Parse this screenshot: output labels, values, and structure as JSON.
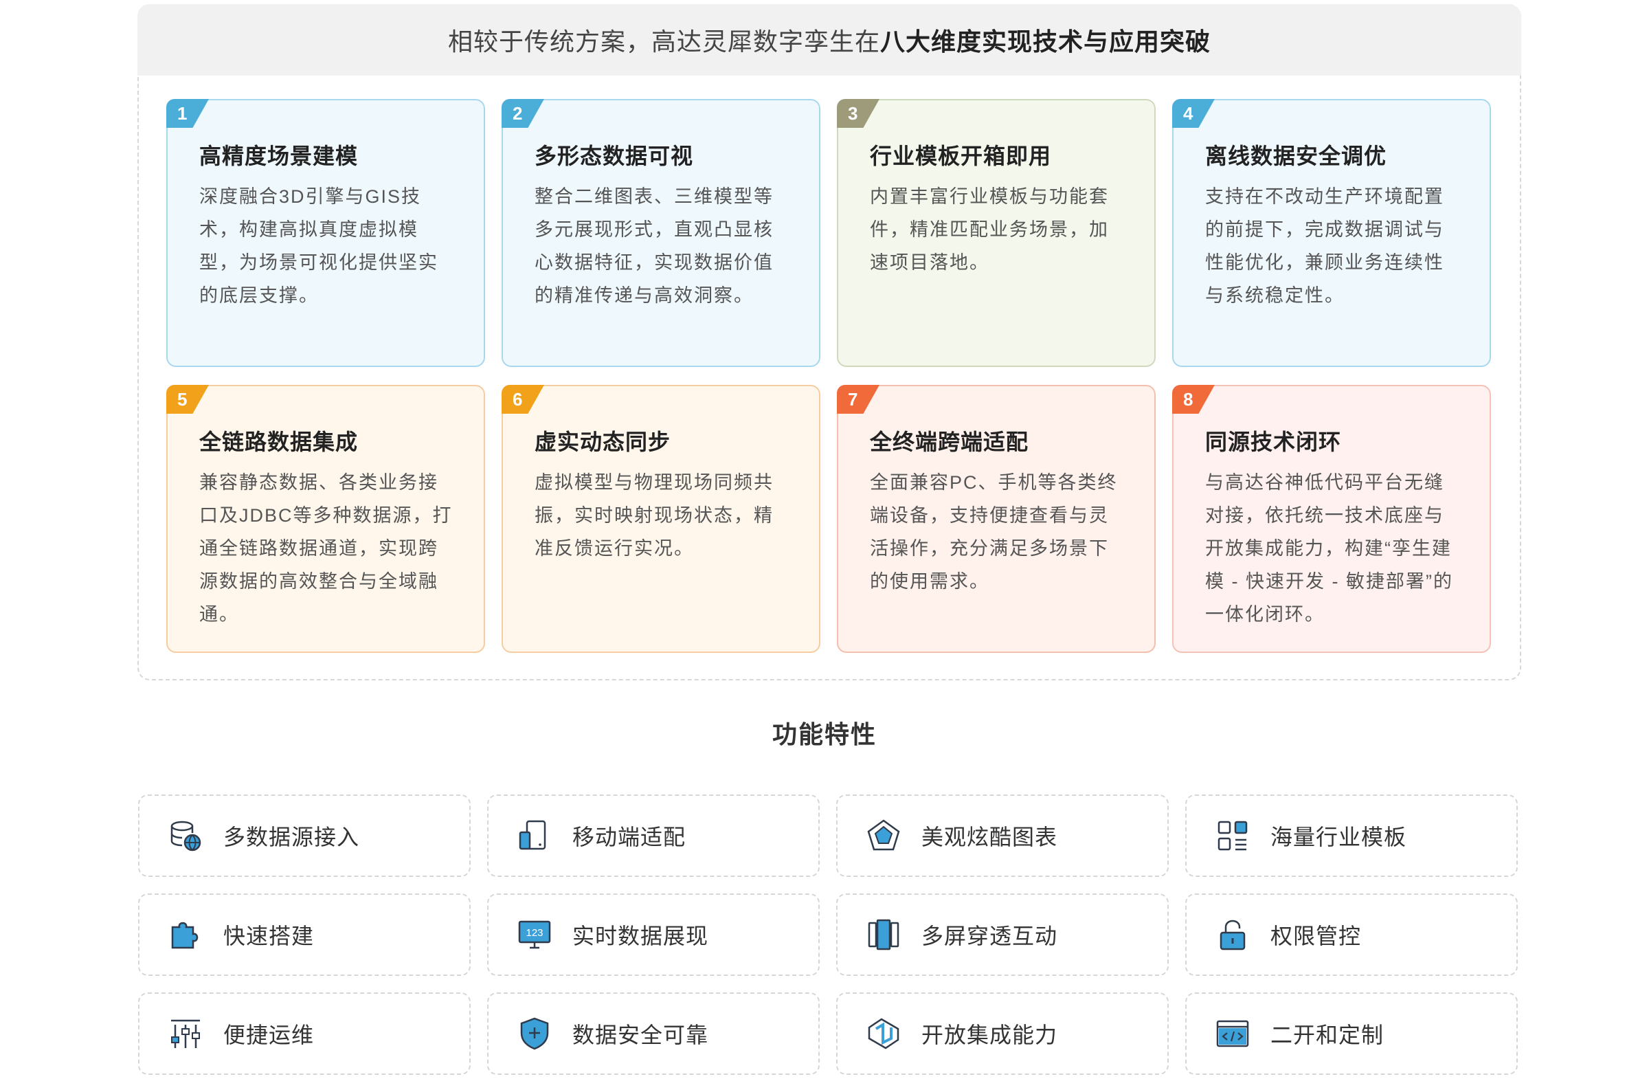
{
  "header": {
    "lead": "相较于传统方案，高达灵犀数字孪生在",
    "highlight": "八大维度实现技术与应用突破"
  },
  "cards": [
    {
      "num": "1",
      "title": "高精度场景建模",
      "desc": "深度融合3D引擎与GIS技术，构建高拟真度虚拟模型，为场景可视化提供坚实的底层支撑。"
    },
    {
      "num": "2",
      "title": "多形态数据可视",
      "desc": "整合二维图表、三维模型等多元展现形式，直观凸显核心数据特征，实现数据价值的精准传递与高效洞察。"
    },
    {
      "num": "3",
      "title": "行业模板开箱即用",
      "desc": "内置丰富行业模板与功能套件，精准匹配业务场景，加速项目落地。"
    },
    {
      "num": "4",
      "title": "离线数据安全调优",
      "desc": "支持在不改动生产环境配置的前提下，完成数据调试与性能优化，兼顾业务连续性与系统稳定性。"
    },
    {
      "num": "5",
      "title": "全链路数据集成",
      "desc": "兼容静态数据、各类业务接口及JDBC等多种数据源，打通全链路数据通道，实现跨源数据的高效整合与全域融通。"
    },
    {
      "num": "6",
      "title": "虚实动态同步",
      "desc": "虚拟模型与物理现场同频共振，实时映射现场状态，精准反馈运行实况。"
    },
    {
      "num": "7",
      "title": "全终端跨端适配",
      "desc": " 全面兼容PC、手机等各类终端设备，支持便捷查看与灵活操作，充分满足多场景下的使用需求。"
    },
    {
      "num": "8",
      "title": "同源技术闭环",
      "desc": "与高达谷神低代码平台无缝对接，依托统一技术底座与开放集成能力，构建“孪生建模 - 快速开发 - 敏捷部署”的一体化闭环。"
    }
  ],
  "features_title": "功能特性",
  "features": [
    {
      "label": "多数据源接入",
      "icon": "database-globe-icon"
    },
    {
      "label": "移动端适配",
      "icon": "mobile-device-icon"
    },
    {
      "label": "美观炫酷图表",
      "icon": "pentagon-chart-icon"
    },
    {
      "label": "海量行业模板",
      "icon": "template-grid-icon"
    },
    {
      "label": "快速搭建",
      "icon": "puzzle-icon"
    },
    {
      "label": "实时数据展现",
      "icon": "monitor-123-icon"
    },
    {
      "label": "多屏穿透互动",
      "icon": "multi-screen-icon"
    },
    {
      "label": "权限管控",
      "icon": "lock-icon"
    },
    {
      "label": "便捷运维",
      "icon": "sliders-icon"
    },
    {
      "label": "数据安全可靠",
      "icon": "shield-plus-icon"
    },
    {
      "label": "开放集成能力",
      "icon": "integration-icon"
    },
    {
      "label": "二开和定制",
      "icon": "code-window-icon"
    }
  ],
  "colors": {
    "blue": "#4aaed9",
    "olive": "#9e9b7a",
    "orange": "#f1a21a",
    "red": "#f06a3a",
    "icon_dark": "#2f3a4a",
    "icon_accent": "#3ba0d8"
  }
}
